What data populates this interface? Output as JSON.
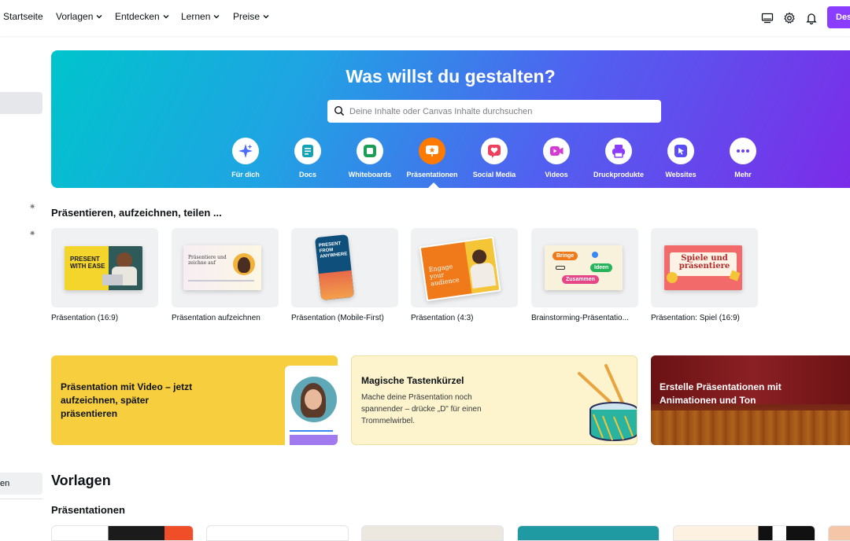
{
  "nav": {
    "items": [
      "Startseite",
      "Vorlagen",
      "Entdecken",
      "Lernen",
      "Preise"
    ],
    "design_button": "Des"
  },
  "sidebar": {
    "bottom_item": "en"
  },
  "hero": {
    "title": "Was willst du gestalten?",
    "search_placeholder": "Deine Inhalte oder Canvas Inhalte durchsuchen",
    "categories": [
      {
        "label": "Für dich",
        "icon": "sparkle-icon",
        "color": "#4a6cf7"
      },
      {
        "label": "Docs",
        "icon": "doc-icon",
        "color": "#13a3b5"
      },
      {
        "label": "Whiteboards",
        "icon": "whiteboard-icon",
        "color": "#1a9e55"
      },
      {
        "label": "Präsentationen",
        "icon": "presentation-icon",
        "color": "#ff7a00"
      },
      {
        "label": "Social Media",
        "icon": "heart-icon",
        "color": "#f03e5d"
      },
      {
        "label": "Videos",
        "icon": "video-icon",
        "color": "#d63bd1"
      },
      {
        "label": "Druckprodukte",
        "icon": "printer-icon",
        "color": "#8b3dff"
      },
      {
        "label": "Websites",
        "icon": "cursor-icon",
        "color": "#5a4df5"
      },
      {
        "label": "Mehr",
        "icon": "more-icon",
        "color": "#6a3de8"
      }
    ]
  },
  "section": {
    "title": "Präsentieren, aufzeichnen, teilen ...",
    "tiles": [
      {
        "label": "Präsentation (16:9)",
        "thumb_text": "PRESENT WITH EASE"
      },
      {
        "label": "Präsentation aufzeichnen",
        "thumb_text": "Präsentiere und zeichne auf"
      },
      {
        "label": "Präsentation (Mobile-First)",
        "thumb_text": "PRESENT FROM ANYWHERE"
      },
      {
        "label": "Präsentation (4:3)",
        "thumb_text": "Engage your audience"
      },
      {
        "label": "Brainstorming-Präsentatio...",
        "thumb_bubbles": [
          "Bringe",
          "Ideen",
          "Zusammen"
        ]
      },
      {
        "label": "Präsentation: Spiel (16:9)",
        "thumb_text": "Spiele und präsentiere"
      }
    ]
  },
  "promos": [
    {
      "title": "Präsentation mit Video – jetzt aufzeichnen, später präsentieren"
    },
    {
      "title": "Magische Tastenkürzel",
      "text": "Mache deine Präsentation noch spannender – drücke „D\" für einen Trommelwirbel."
    },
    {
      "title": "Erstelle Präsentationen mit Animationen und Ton"
    }
  ],
  "templates": {
    "title": "Vorlagen",
    "subtitle": "Präsentationen"
  }
}
